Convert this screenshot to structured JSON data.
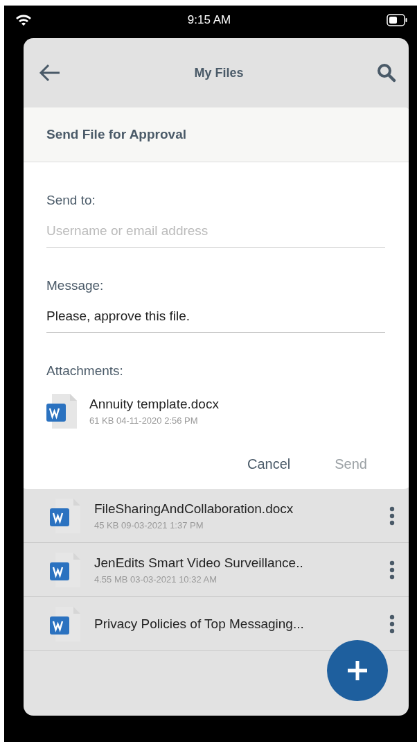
{
  "status_bar": {
    "time": "9:15 AM"
  },
  "header": {
    "title": "My Files"
  },
  "dialog": {
    "title": "Send File for Approval",
    "fields": [
      {
        "label": "Send to:",
        "placeholder": "Username or email address"
      },
      {
        "label": "Message:",
        "value": "Please, approve this file."
      }
    ],
    "attachments_label": "Attachments:",
    "attachments": [
      {
        "name": "Annuity template.docx",
        "meta": "61 KB 04-11-2020 2:56 PM"
      }
    ],
    "buttons": [
      {
        "label": "Cancel",
        "disabled": false
      },
      {
        "label": "Send",
        "disabled": true
      }
    ]
  },
  "files": [
    {
      "name": "FileSharingAndCollaboration.docx",
      "meta": "45 KB 09-03-2021 1:37 PM"
    },
    {
      "name": "JenEdits Smart Video Surveillance..",
      "meta": "4.55 MB 03-03-2021 10:32 AM"
    },
    {
      "name": "Privacy Policies of Top Messaging..."
    }
  ]
}
